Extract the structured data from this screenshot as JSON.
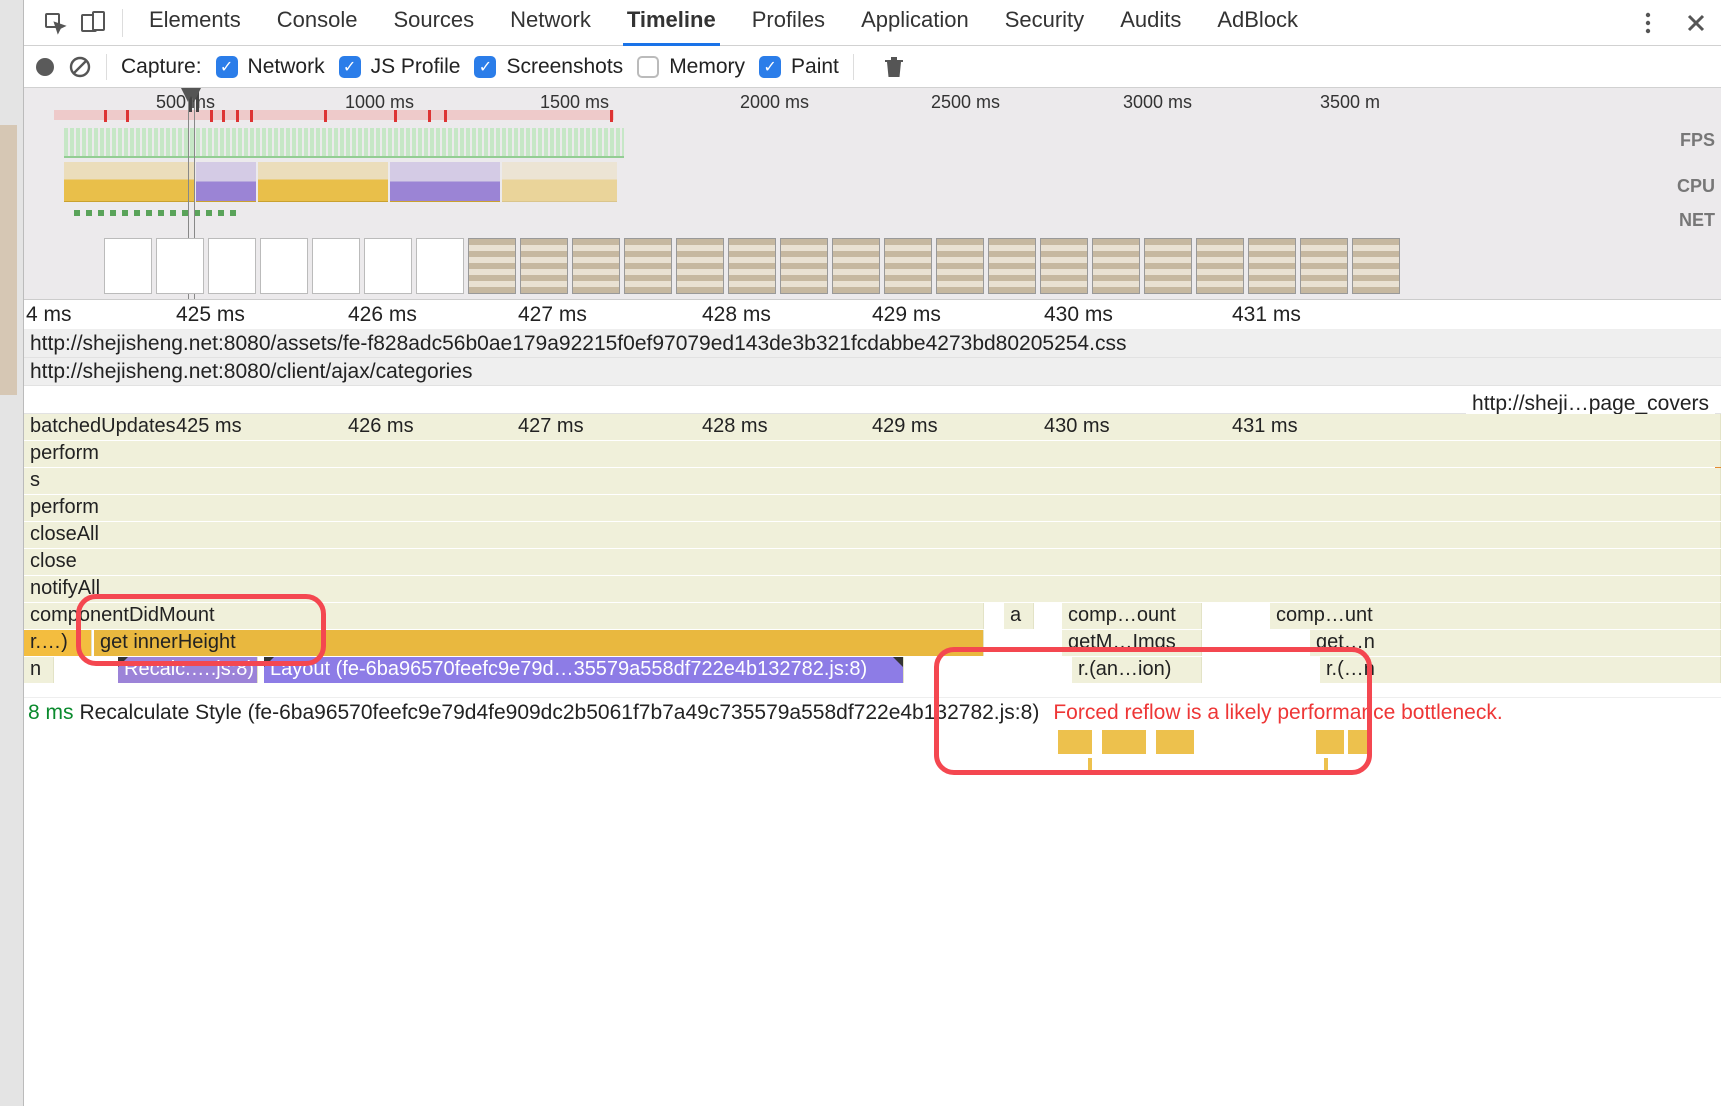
{
  "tabs": {
    "elements": "Elements",
    "console": "Console",
    "sources": "Sources",
    "network": "Network",
    "timeline": "Timeline",
    "profiles": "Profiles",
    "application": "Application",
    "security": "Security",
    "audits": "Audits",
    "adblock": "AdBlock"
  },
  "toolbar": {
    "capture_label": "Capture:",
    "network": "Network",
    "js_profile": "JS Profile",
    "screenshots": "Screenshots",
    "memory": "Memory",
    "paint": "Paint"
  },
  "overview": {
    "ticks": [
      "500 ms",
      "1000 ms",
      "1500 ms",
      "2000 ms",
      "2500 ms",
      "3000 ms",
      "3500 m"
    ],
    "labels": {
      "fps": "FPS",
      "cpu": "CPU",
      "net": "NET"
    }
  },
  "detail_ruler_left": "4 ms",
  "detail_ruler": [
    "425 ms",
    "426 ms",
    "427 ms",
    "428 ms",
    "429 ms",
    "430 ms",
    "431 ms"
  ],
  "urls": {
    "css": "http://shejisheng.net:8080/assets/fe-f828adc56b0ae179a92215f0ef97079ed143de3b321fcdabbe4273bd80205254.css",
    "ajax": "http://shejisheng.net:8080/client/ajax/categories",
    "short": "http://sheji…page_covers"
  },
  "flame_ruler_left": "4 ms",
  "flame": {
    "r0": "batchedUpdates",
    "r1": "perform",
    "r2": "s",
    "r3": "perform",
    "r4": "closeAll",
    "r5": "close",
    "r6": "notifyAll",
    "r7": "componentDidMount",
    "r7b": "a",
    "r7c": "comp…ount",
    "r7d": "comp…unt",
    "r8a": "r.…)",
    "r8b": "get innerHeight",
    "r8c": "getM…Imgs",
    "r8d": "get…n",
    "r9a": "n",
    "r9b": "Recalc.….js:8)",
    "r9c": "Layout (fe-6ba96570feefc9e79d…35579a558df722e4b132782.js:8)",
    "r9d": "r.(an…ion)",
    "r9e": "r.(…n"
  },
  "bottom": {
    "ms": "8 ms",
    "text": "Recalculate Style (fe-6ba96570feefc9e79d4fe909dc2b5061f7b7a49c735579a558df722e4b132782.js:8)",
    "warn": "Forced reflow is a likely performance bottleneck."
  }
}
